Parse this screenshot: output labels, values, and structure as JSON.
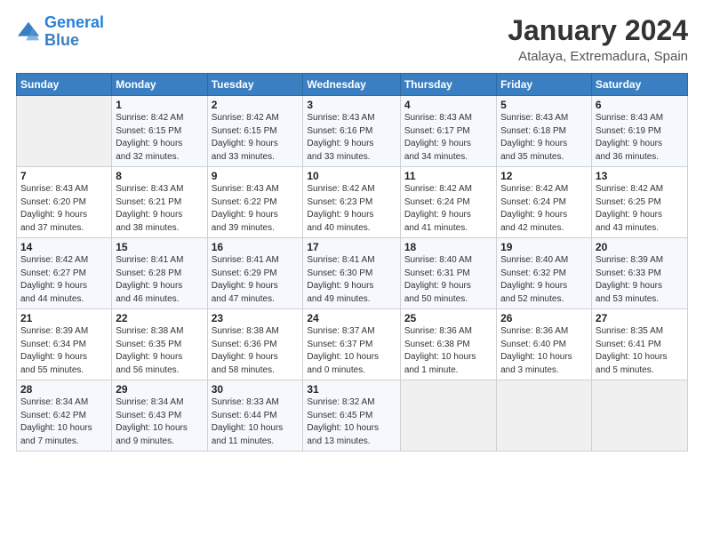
{
  "logo": {
    "line1": "General",
    "line2": "Blue"
  },
  "title": "January 2024",
  "subtitle": "Atalaya, Extremadura, Spain",
  "days_header": [
    "Sunday",
    "Monday",
    "Tuesday",
    "Wednesday",
    "Thursday",
    "Friday",
    "Saturday"
  ],
  "weeks": [
    [
      {
        "day": "",
        "info": ""
      },
      {
        "day": "1",
        "info": "Sunrise: 8:42 AM\nSunset: 6:15 PM\nDaylight: 9 hours\nand 32 minutes."
      },
      {
        "day": "2",
        "info": "Sunrise: 8:42 AM\nSunset: 6:15 PM\nDaylight: 9 hours\nand 33 minutes."
      },
      {
        "day": "3",
        "info": "Sunrise: 8:43 AM\nSunset: 6:16 PM\nDaylight: 9 hours\nand 33 minutes."
      },
      {
        "day": "4",
        "info": "Sunrise: 8:43 AM\nSunset: 6:17 PM\nDaylight: 9 hours\nand 34 minutes."
      },
      {
        "day": "5",
        "info": "Sunrise: 8:43 AM\nSunset: 6:18 PM\nDaylight: 9 hours\nand 35 minutes."
      },
      {
        "day": "6",
        "info": "Sunrise: 8:43 AM\nSunset: 6:19 PM\nDaylight: 9 hours\nand 36 minutes."
      }
    ],
    [
      {
        "day": "7",
        "info": "Sunrise: 8:43 AM\nSunset: 6:20 PM\nDaylight: 9 hours\nand 37 minutes."
      },
      {
        "day": "8",
        "info": "Sunrise: 8:43 AM\nSunset: 6:21 PM\nDaylight: 9 hours\nand 38 minutes."
      },
      {
        "day": "9",
        "info": "Sunrise: 8:43 AM\nSunset: 6:22 PM\nDaylight: 9 hours\nand 39 minutes."
      },
      {
        "day": "10",
        "info": "Sunrise: 8:42 AM\nSunset: 6:23 PM\nDaylight: 9 hours\nand 40 minutes."
      },
      {
        "day": "11",
        "info": "Sunrise: 8:42 AM\nSunset: 6:24 PM\nDaylight: 9 hours\nand 41 minutes."
      },
      {
        "day": "12",
        "info": "Sunrise: 8:42 AM\nSunset: 6:24 PM\nDaylight: 9 hours\nand 42 minutes."
      },
      {
        "day": "13",
        "info": "Sunrise: 8:42 AM\nSunset: 6:25 PM\nDaylight: 9 hours\nand 43 minutes."
      }
    ],
    [
      {
        "day": "14",
        "info": "Sunrise: 8:42 AM\nSunset: 6:27 PM\nDaylight: 9 hours\nand 44 minutes."
      },
      {
        "day": "15",
        "info": "Sunrise: 8:41 AM\nSunset: 6:28 PM\nDaylight: 9 hours\nand 46 minutes."
      },
      {
        "day": "16",
        "info": "Sunrise: 8:41 AM\nSunset: 6:29 PM\nDaylight: 9 hours\nand 47 minutes."
      },
      {
        "day": "17",
        "info": "Sunrise: 8:41 AM\nSunset: 6:30 PM\nDaylight: 9 hours\nand 49 minutes."
      },
      {
        "day": "18",
        "info": "Sunrise: 8:40 AM\nSunset: 6:31 PM\nDaylight: 9 hours\nand 50 minutes."
      },
      {
        "day": "19",
        "info": "Sunrise: 8:40 AM\nSunset: 6:32 PM\nDaylight: 9 hours\nand 52 minutes."
      },
      {
        "day": "20",
        "info": "Sunrise: 8:39 AM\nSunset: 6:33 PM\nDaylight: 9 hours\nand 53 minutes."
      }
    ],
    [
      {
        "day": "21",
        "info": "Sunrise: 8:39 AM\nSunset: 6:34 PM\nDaylight: 9 hours\nand 55 minutes."
      },
      {
        "day": "22",
        "info": "Sunrise: 8:38 AM\nSunset: 6:35 PM\nDaylight: 9 hours\nand 56 minutes."
      },
      {
        "day": "23",
        "info": "Sunrise: 8:38 AM\nSunset: 6:36 PM\nDaylight: 9 hours\nand 58 minutes."
      },
      {
        "day": "24",
        "info": "Sunrise: 8:37 AM\nSunset: 6:37 PM\nDaylight: 10 hours\nand 0 minutes."
      },
      {
        "day": "25",
        "info": "Sunrise: 8:36 AM\nSunset: 6:38 PM\nDaylight: 10 hours\nand 1 minute."
      },
      {
        "day": "26",
        "info": "Sunrise: 8:36 AM\nSunset: 6:40 PM\nDaylight: 10 hours\nand 3 minutes."
      },
      {
        "day": "27",
        "info": "Sunrise: 8:35 AM\nSunset: 6:41 PM\nDaylight: 10 hours\nand 5 minutes."
      }
    ],
    [
      {
        "day": "28",
        "info": "Sunrise: 8:34 AM\nSunset: 6:42 PM\nDaylight: 10 hours\nand 7 minutes."
      },
      {
        "day": "29",
        "info": "Sunrise: 8:34 AM\nSunset: 6:43 PM\nDaylight: 10 hours\nand 9 minutes."
      },
      {
        "day": "30",
        "info": "Sunrise: 8:33 AM\nSunset: 6:44 PM\nDaylight: 10 hours\nand 11 minutes."
      },
      {
        "day": "31",
        "info": "Sunrise: 8:32 AM\nSunset: 6:45 PM\nDaylight: 10 hours\nand 13 minutes."
      },
      {
        "day": "",
        "info": ""
      },
      {
        "day": "",
        "info": ""
      },
      {
        "day": "",
        "info": ""
      }
    ]
  ]
}
